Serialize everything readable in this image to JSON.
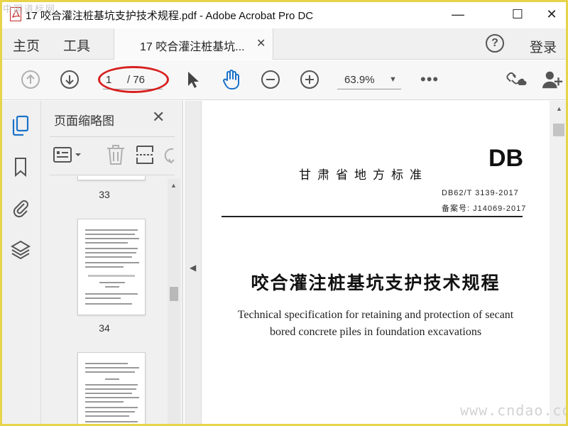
{
  "window": {
    "title": "17 咬合灌注桩基坑支护技术规程.pdf - Adobe Acrobat Pro DC",
    "minimize_glyph": "—",
    "maximize_glyph": "☐",
    "close_glyph": "✕"
  },
  "watermark": {
    "top_left": "中国道标网",
    "bottom_right": "www.cndao.com"
  },
  "menu": {
    "home": "主页",
    "tools": "工具",
    "doc_tab": "17 咬合灌注桩基坑...",
    "doc_tab_close": "✕",
    "help": "?",
    "login": "登录"
  },
  "toolbar": {
    "page_current": "1",
    "page_total": "/ 76",
    "zoom": "63.9%",
    "zoom_arrow": "▼",
    "more": "•••",
    "icons": [
      "prev-page-icon",
      "next-page-icon",
      "select-arrow-icon",
      "hand-icon",
      "zoom-out-icon",
      "zoom-in-icon",
      "share-link-icon",
      "add-user-icon"
    ]
  },
  "rail": {
    "icons": [
      "page-thumbnails-icon",
      "bookmark-icon",
      "attachment-icon",
      "layers-icon"
    ],
    "active_color": "#1a73c9"
  },
  "thumbnails": {
    "title": "页面缩略图",
    "close": "✕",
    "labels": [
      "33",
      "34"
    ]
  },
  "document": {
    "standard_header": "甘肃省地方标准",
    "db_mark": "DB",
    "standard_number": "DB62/T 3139-2017",
    "record_number": "备案号: J14069-2017",
    "title_cn": "咬合灌注桩基坑支护技术规程",
    "title_en_line1": "Technical specification for retaining and protection of secant",
    "title_en_line2": "bored concrete piles in foundation excavations"
  },
  "colors": {
    "accent_blue": "#1a73c9",
    "oval_red": "#d82020",
    "frame_yellow": "#e8d44a"
  }
}
